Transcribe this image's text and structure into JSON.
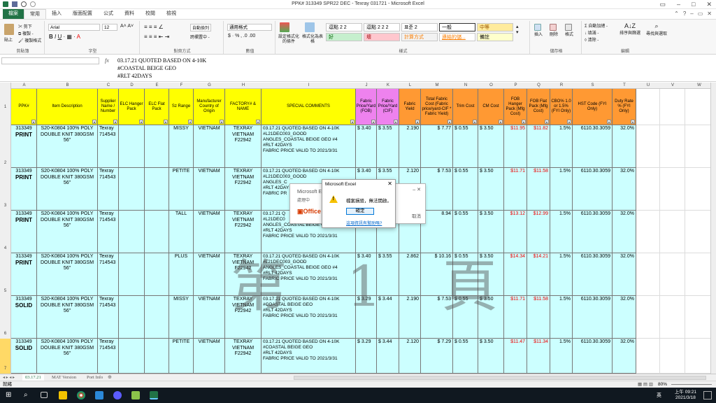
{
  "window": {
    "title": "PPK# 313349 SPR22 DEC - Texray 031721 - Microsoft Excel"
  },
  "ribbon_tabs": [
    "檔案",
    "常用",
    "插入",
    "版面配置",
    "公式",
    "資料",
    "校閱",
    "檢視"
  ],
  "ribbon": {
    "clipboard": {
      "cut": "剪下",
      "copy": "複製 -",
      "painter": "複製格式",
      "paste": "貼上",
      "label": "剪貼簿"
    },
    "font": {
      "name": "Arial",
      "size": "12",
      "label": "字型"
    },
    "alignment": {
      "wrap": "自動換列",
      "merge": "跨欄置中 -",
      "label": "對齊方式"
    },
    "number": {
      "format": "通用格式",
      "label": "數值"
    },
    "styles": {
      "conditional": "設定格式化的條件",
      "table": "格式化為表格",
      "cells": [
        {
          "text": "逗點 2 2",
          "bg": "#ffffff",
          "fg": "#000000"
        },
        {
          "text": "逗點 2 2 2",
          "bg": "#ffffff",
          "fg": "#000000"
        },
        {
          "text": "표준 2",
          "bg": "#ffffff",
          "fg": "#000000"
        },
        {
          "text": "一般",
          "bg": "#ffffff",
          "fg": "#000000"
        },
        {
          "text": "中等",
          "bg": "#ffeb9c",
          "fg": "#9c5700"
        },
        {
          "text": "好",
          "bg": "#c6efce",
          "fg": "#006100"
        },
        {
          "text": "壞",
          "bg": "#ffc7ce",
          "fg": "#9c0006"
        },
        {
          "text": "計算方式",
          "bg": "#f2f2f2",
          "fg": "#fa7d00"
        },
        {
          "text": "連結的儲...",
          "bg": "#ffffff",
          "fg": "#fa7d00"
        },
        {
          "text": "備註",
          "bg": "#ffffcc",
          "fg": "#000000"
        }
      ],
      "label": "樣式"
    },
    "cells_group": {
      "insert": "插入",
      "delete": "刪除",
      "format": "格式",
      "label": "儲存格"
    },
    "editing": {
      "autosum": "自動加總 -",
      "fill": "填滿 -",
      "clear": "清除 -",
      "sort": "排序與篩選",
      "find": "尋找與選取",
      "label": "編輯"
    }
  },
  "formula_bar": {
    "fx": "fx",
    "content": "03.17.21 QUOTED BASED ON 4-10K\n#COASTAL BEIGE GEO\n#RLT 42DAYS"
  },
  "columns": [
    "A",
    "B",
    "C",
    "D",
    "E",
    "F",
    "G",
    "H",
    "I",
    "J",
    "K",
    "L",
    "M",
    "N",
    "O",
    "P",
    "Q",
    "R",
    "S",
    "T",
    "U",
    "V",
    "W"
  ],
  "headers": [
    {
      "text": "PPK#",
      "bg": "#ffff00"
    },
    {
      "text": "Item Description",
      "bg": "#ffff00"
    },
    {
      "text": "Supplier Name / Number",
      "bg": "#ffff00"
    },
    {
      "text": "ELC Hanger Pack",
      "bg": "#ffff00"
    },
    {
      "text": "ELC Flat Pack",
      "bg": "#ffff00"
    },
    {
      "text": "Sz Range",
      "bg": "#ffff00"
    },
    {
      "text": "Manufacturer Country of Origin",
      "bg": "#ffff00"
    },
    {
      "text": "FACTORY# & NAME",
      "bg": "#ffff00"
    },
    {
      "text": "SPECIAL COMMENTS",
      "bg": "#ffff00"
    },
    {
      "text": "Fabric Price/Yard (FOB)",
      "bg": "#ee82ee"
    },
    {
      "text": "Fabric Price/Yard (CIF)",
      "bg": "#ee82ee"
    },
    {
      "text": "Fabric Yield",
      "bg": "#ff9933"
    },
    {
      "text": "Total Fabric Cost (Fabric price/yard-CIF * Fabric Yield)",
      "bg": "#ff9933"
    },
    {
      "text": "Trim Cost",
      "bg": "#ff9933"
    },
    {
      "text": "CM Cost",
      "bg": "#ff9933"
    },
    {
      "text": "FOB Hanger Pack (Mfg Cost)",
      "bg": "#ff9933"
    },
    {
      "text": "FOB Flat Pack (Mfg Cost)",
      "bg": "#ff9933"
    },
    {
      "text": "CBO% 1.0 or 1.5% (FYI Only)",
      "bg": "#ff9933"
    },
    {
      "text": "HST Code (FYI Only)",
      "bg": "#ff9933"
    },
    {
      "text": "Duty Rate % (FYI Only)",
      "bg": "#ff9933"
    }
  ],
  "row_numbers": [
    "1",
    "2",
    "3",
    "4",
    "5",
    "6",
    "7"
  ],
  "rows": [
    {
      "ppk": "313349",
      "type": "PRINT",
      "desc": "S20-K0804 100% POLY DOUBLE KNIT 380GSM 56\"",
      "supplier": "Texray 714543",
      "size": "MISSY",
      "country": "VIETNAM",
      "factory": "TEXRAY VIETNAM F22942",
      "comments": "03.17.21 QUOTED BASED ON 4-10K\n#L21DEC003_GOOD\nANGLES_COASTAL BEIGE GEO #4\n#RLT 42DAYS\nFABRIC PRICE VALID TO 2021/3/31",
      "fob": "$  3.40",
      "cif": "$  3.55",
      "yield": "2.190",
      "total": "$     7.77",
      "trim": "$   0.55",
      "cm": "$   3.50",
      "hanger": "$11.95",
      "flat": "$11.82",
      "cbo": "1.5%",
      "hst": "6110.30.3059",
      "duty": "32.0%"
    },
    {
      "ppk": "313349",
      "type": "PRINT",
      "desc": "S20-K0804 100% POLY DOUBLE KNIT 380GSM 56\"",
      "supplier": "Texray 714543",
      "size": "PETITE",
      "country": "VIETNAM",
      "factory": "TEXRAY VIETNAM F22942",
      "comments": "03.17.21 QUOTED BASED ON 4-10K\n#L21DEC003_GOOD\nANGLES_C\n#RLT 42DAY\nFABRIC PR",
      "fob": "$  3.40",
      "cif": "$  3.55",
      "yield": "2.120",
      "total": "$     7.53",
      "trim": "$   0.55",
      "cm": "$   3.50",
      "hanger": "$11.71",
      "flat": "$11.58",
      "cbo": "1.5%",
      "hst": "6110.30.3059",
      "duty": "32.0%"
    },
    {
      "ppk": "313349",
      "type": "PRINT",
      "desc": "S20-K0804 100% POLY DOUBLE KNIT 380GSM 56\"",
      "supplier": "Texray 714543",
      "size": "TALL",
      "country": "VIETNAM",
      "factory": "TEXRAY VIETNAM F22942",
      "comments": "03.17.21 Q\n#L21DEC0\nANGLES_COASTAL BEIGE GEO\n#RLT 42DAYS\nFABRIC PRICE VALID TO 2021/3/31",
      "fob": "",
      "cif": "",
      "yield": "",
      "total": "8.94",
      "trim": "$   0.55",
      "cm": "$   3.50",
      "hanger": "$13.12",
      "flat": "$12.99",
      "cbo": "1.5%",
      "hst": "6110.30.3059",
      "duty": "32.0%"
    },
    {
      "ppk": "313349",
      "type": "PRINT",
      "desc": "S20-K0804 100% POLY DOUBLE KNIT 380GSM 56\"",
      "supplier": "Texray 714543",
      "size": "PLUS",
      "country": "VIETNAM",
      "factory": "TEXRAY VIETNAM F22942",
      "comments": "03.17.21 QUOTED BASED ON 4-10K\n#L21DEC003_GOOD\nANGLES_COASTAL BEIGE GEO #4\n#RLT 42DAYS\nFABRIC PRICE VALID TO 2021/3/31",
      "fob": "$  3.40",
      "cif": "$  3.55",
      "yield": "2.862",
      "total": "$   10.16",
      "trim": "$   0.55",
      "cm": "$   3.50",
      "hanger": "$14.34",
      "flat": "$14.21",
      "cbo": "1.5%",
      "hst": "6110.30.3059",
      "duty": "32.0%"
    },
    {
      "ppk": "313349",
      "type": "SOLID",
      "desc": "S20-K0804 100% POLY DOUBLE KNIT 380GSM 56\"",
      "supplier": "Texray 714543",
      "size": "MISSY",
      "country": "VIETNAM",
      "factory": "TEXRAY VIETNAM F22942",
      "comments": "03.17.21 QUOTED BASED ON 4-10K\n#COASTAL BEIGE GEO\n#RLT 42DAYS\nFABRIC PRICE VALID TO 2021/3/31",
      "fob": "$  3.29",
      "cif": "$  3.44",
      "yield": "2.190",
      "total": "$     7.53",
      "trim": "$   0.55",
      "cm": "$   3.50",
      "hanger": "$11.71",
      "flat": "$11.58",
      "cbo": "1.5%",
      "hst": "6110.30.3059",
      "duty": "32.0%"
    },
    {
      "ppk": "313349",
      "type": "SOLID",
      "desc": "S20-K0804 100% POLY DOUBLE KNIT 380GSM 56\"",
      "supplier": "Texray 714543",
      "size": "PETITE",
      "country": "VIETNAM",
      "factory": "TEXRAY VIETNAM F22942",
      "comments": "03.17.21 QUOTED BASED ON 4-10K\n#COASTAL BEIGE GEO\n#RLT 42DAYS\nFABRIC PRICE VALID TO 2021/3/31",
      "fob": "$  3.29",
      "cif": "$  3.44",
      "yield": "2.120",
      "total": "$     7.29",
      "trim": "$   0.55",
      "cm": "$   3.50",
      "hanger": "$11.47",
      "flat": "$11.34",
      "cbo": "1.5%",
      "hst": "6110.30.3059",
      "duty": "32.0%"
    }
  ],
  "watermark": "第 1 頁",
  "splash": {
    "text": "Microsoft E",
    "sub": "處理中",
    "brand": "Office",
    "cancel": "取消"
  },
  "dialog": {
    "title": "Microsoft Excel",
    "close": "✕",
    "message": "檔案損毀，無法開啟。",
    "ok": "確定",
    "link": "這項資訊有幫助嗎?"
  },
  "sheet_tabs": [
    "03.17.21",
    "MAT Version",
    "Port Info"
  ],
  "status": {
    "ready": "就緒",
    "zoom": "80%"
  },
  "taskbar": {
    "time": "上午 09:21",
    "date": "2021/3/18",
    "ime": "英"
  }
}
